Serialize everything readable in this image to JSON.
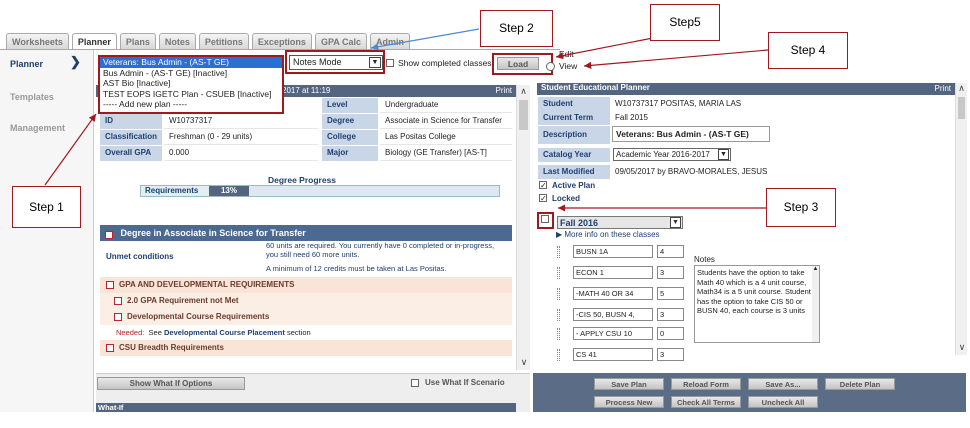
{
  "tabs": [
    "Worksheets",
    "Planner",
    "Plans",
    "Notes",
    "Petitions",
    "Exceptions",
    "GPA Calc",
    "Admin"
  ],
  "active_tab": "Planner",
  "left_nav": [
    "Planner",
    "Templates",
    "Management"
  ],
  "plan_dropdown": {
    "options": [
      "Veterans: Bus Admin - (AS-T GE)",
      "Bus Admin - (AS-T GE) [Inactive]",
      "AST Bio [Inactive]",
      "TEST EOPS IGETC Plan - CSUEB [Inactive]",
      "----- Add new plan -----"
    ],
    "selected": "Veterans: Bus Admin - (AS-T GE)"
  },
  "mode_select": "Notes Mode",
  "show_completed_label": "Show completed classes",
  "load_button": "Load",
  "edit_label": "Edit",
  "view_label": "View",
  "left_panel": {
    "header_date": "2017 at 11:19",
    "print": "Print",
    "info": [
      {
        "l1": "ID",
        "v1": "W10737317",
        "l2": "Degree",
        "v2": "Associate in Science for Transfer"
      },
      {
        "l1": "Classification",
        "v1": "Freshman (0 - 29 units)",
        "l2": "College",
        "v2": "Las Positas College"
      },
      {
        "l1": "Overall GPA",
        "v1": "0.000",
        "l2": "Major",
        "v2": "Biology (GE Transfer) [AS-T]"
      }
    ],
    "level_label": "Level",
    "level_value": "Undergraduate",
    "progress_title": "Degree Progress",
    "progress_label": "Requirements",
    "progress_pct": "13%",
    "progress_fraction": 0.13,
    "degree_title": "Degree in Associate in Science for Transfer",
    "unmet_label": "Unmet conditions",
    "unmet_text1": "60 units are required. You currently have 0 completed or in-progress, you still need 60 more units.",
    "unmet_text2": "A minimum of 12 credits must be taken at Las Positas.",
    "requirements": [
      "GPA AND DEVELOPMENTAL REQUIREMENTS",
      "2.0 GPA Requirement not Met",
      "Developmental Course Requirements"
    ],
    "needed_label": "Needed:",
    "needed_see": "See",
    "needed_link": "Developmental Course Placement",
    "needed_suffix": "section",
    "csu_req": "CSU Breadth Requirements",
    "whatif_button": "Show What If Options",
    "whatif_checkbox": "Use What If Scenario",
    "whatif_header": "What-If"
  },
  "right_panel": {
    "title": "Student Educational Planner",
    "print": "Print",
    "rows": [
      {
        "label": "Student",
        "value": "W10737317 POSITAS, MARIA LAS"
      },
      {
        "label": "Current Term",
        "value": "Fall 2015"
      }
    ],
    "description_label": "Description",
    "description_value": "Veterans: Bus Admin - (AS-T GE)",
    "catalog_label": "Catalog Year",
    "catalog_value": "Academic Year 2016-2017",
    "modified_label": "Last Modified",
    "modified_value": "09/05/2017 by BRAVO-MORALES, JESUS",
    "active_plan": "Active Plan",
    "locked": "Locked",
    "term": "Fall 2016",
    "more_info": "More info on these classes",
    "courses": [
      {
        "name": "BUSN 1A",
        "units": "4"
      },
      {
        "name": "ECON 1",
        "units": "3"
      },
      {
        "name": "-MATH 40 OR 34",
        "units": "5"
      },
      {
        "name": "-CIS 50, BUSN 4,",
        "units": "3"
      },
      {
        "name": "- APPLY CSU 10",
        "units": "0"
      },
      {
        "name": "CS 41",
        "units": "3"
      }
    ],
    "notes_label": "Notes",
    "notes_text": "Students have the option to take Math 40 which is a 4 unit course, Math34 is a 5 unit course. Student has the option to take CIS 50 or BUSN 40, each course is  3 units",
    "buttons_row1": [
      "Save Plan",
      "Reload Form",
      "Save As...",
      "Delete Plan"
    ],
    "buttons_row2": [
      "Process New",
      "Check All Terms",
      "Uncheck All"
    ]
  },
  "callouts": {
    "step1": "Step 1",
    "step2": "Step 2",
    "step3": "Step 3",
    "step4": "Step 4",
    "step5": "Step5"
  },
  "colors": {
    "annotation_red": "#a01820",
    "header_blue": "#53657f",
    "label_blue": "#c9d6e8",
    "select_blue": "#2a6fd1"
  }
}
